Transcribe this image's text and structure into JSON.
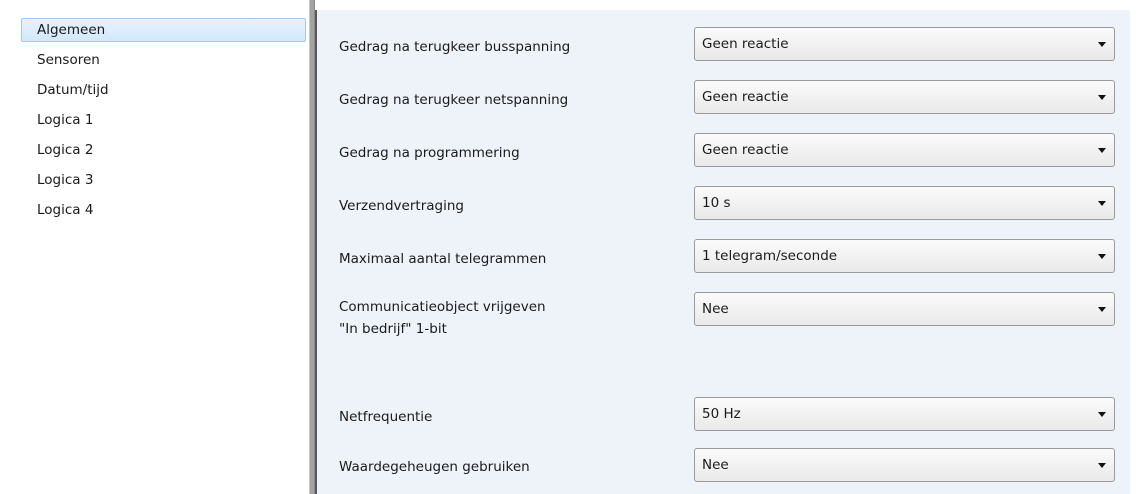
{
  "sidebar": {
    "items": [
      {
        "label": "Algemeen",
        "selected": true
      },
      {
        "label": "Sensoren"
      },
      {
        "label": "Datum/tijd"
      },
      {
        "label": "Logica 1"
      },
      {
        "label": "Logica 2"
      },
      {
        "label": "Logica 3"
      },
      {
        "label": "Logica 4"
      }
    ]
  },
  "params": [
    {
      "label": "Gedrag na terugkeer busspanning",
      "value": "Geen reactie"
    },
    {
      "label": "Gedrag na terugkeer netspanning",
      "value": "Geen reactie"
    },
    {
      "label": "Gedrag na programmering",
      "value": "Geen reactie"
    },
    {
      "label": "Verzendvertraging",
      "value": "10 s"
    },
    {
      "label": "Maximaal aantal telegrammen",
      "value": "1 telegram/seconde"
    },
    {
      "label_line1": "Communicatieobject vrijgeven",
      "label_line2": "\"In bedrijf\" 1-bit",
      "value": "Nee"
    },
    {
      "label": "Netfrequentie",
      "value": "50 Hz"
    },
    {
      "label": "Waardegeheugen gebruiken",
      "value": "Nee"
    }
  ],
  "colors": {
    "panel_bg": "#eef3fa",
    "selection_bg": "#d3e8fb",
    "selection_border": "#9fc9ef"
  }
}
